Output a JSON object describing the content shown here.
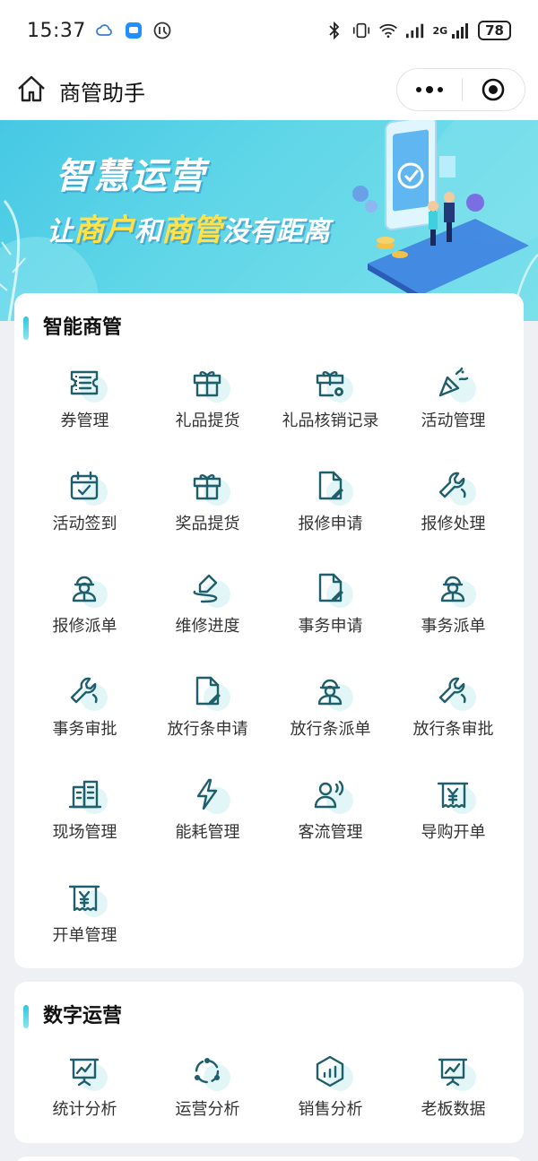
{
  "status_bar": {
    "time": "15:37",
    "network_label": "2G",
    "battery": "78"
  },
  "title_bar": {
    "title": "商管助手"
  },
  "banner": {
    "line1": "智慧运营",
    "line2_a": "让",
    "line2_b": "商户",
    "line2_c": "和",
    "line2_d": "商管",
    "line2_e": "没有距离"
  },
  "sections": [
    {
      "title": "智能商管",
      "items": [
        {
          "label": "券管理",
          "icon": "coupon-icon"
        },
        {
          "label": "礼品提货",
          "icon": "gift-icon"
        },
        {
          "label": "礼品核销记录",
          "icon": "gift-settings-icon"
        },
        {
          "label": "活动管理",
          "icon": "party-popper-icon"
        },
        {
          "label": "活动签到",
          "icon": "calendar-check-icon"
        },
        {
          "label": "奖品提货",
          "icon": "gift-icon"
        },
        {
          "label": "报修申请",
          "icon": "document-edit-icon"
        },
        {
          "label": "报修处理",
          "icon": "wrench-icon"
        },
        {
          "label": "报修派单",
          "icon": "worker-icon"
        },
        {
          "label": "维修进度",
          "icon": "pen-progress-icon"
        },
        {
          "label": "事务申请",
          "icon": "document-edit-icon"
        },
        {
          "label": "事务派单",
          "icon": "worker-icon"
        },
        {
          "label": "事务审批",
          "icon": "wrench-icon"
        },
        {
          "label": "放行条申请",
          "icon": "document-edit-icon"
        },
        {
          "label": "放行条派单",
          "icon": "worker-icon"
        },
        {
          "label": "放行条审批",
          "icon": "wrench-icon"
        },
        {
          "label": "现场管理",
          "icon": "building-icon"
        },
        {
          "label": "能耗管理",
          "icon": "lightning-icon"
        },
        {
          "label": "客流管理",
          "icon": "person-voice-icon"
        },
        {
          "label": "导购开单",
          "icon": "receipt-yen-icon"
        },
        {
          "label": "开单管理",
          "icon": "receipt-yen-icon"
        }
      ]
    },
    {
      "title": "数字运营",
      "items": [
        {
          "label": "统计分析",
          "icon": "presentation-chart-icon"
        },
        {
          "label": "运营分析",
          "icon": "cycle-icon"
        },
        {
          "label": "销售分析",
          "icon": "hexagon-chart-icon"
        },
        {
          "label": "老板数据",
          "icon": "presentation-chart-icon"
        }
      ]
    }
  ],
  "colors": {
    "icon_stroke": "#1f5f6b",
    "icon_accent": "#e2f6f8",
    "section_bar": "#2ec5e0",
    "banner_bg": "#46c8e4",
    "banner_highlight": "#ffe24a"
  }
}
